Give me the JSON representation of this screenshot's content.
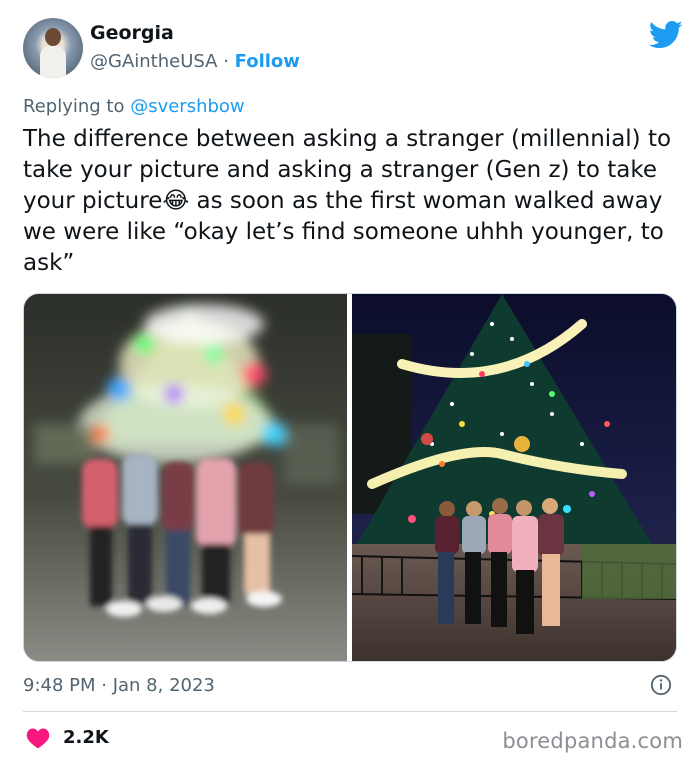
{
  "author": {
    "display_name": "Georgia",
    "handle": "@GAintheUSA",
    "separator": " · ",
    "follow_label": "Follow",
    "avatar_icon": "user-avatar"
  },
  "reply": {
    "prefix": "Replying to ",
    "mention": "@svershbow"
  },
  "tweet": {
    "text_before_emoji": "The difference between asking a stranger (millennial) to take your picture and asking a stranger (Gen z) to take your picture",
    "emoji": "😂",
    "text_after_emoji": " as soon as the first woman walked away we were like “okay let’s find someone uhhh younger, to ask”"
  },
  "media": {
    "left_photo_icon": "blurry-christmas-tree-photo",
    "right_photo_icon": "clear-christmas-tree-photo"
  },
  "meta": {
    "time": "9:48 PM",
    "separator": " · ",
    "date": "Jan 8, 2023",
    "likes": "2.2K"
  },
  "watermark": "boredpanda.com",
  "colors": {
    "accent": "#1d9bf0",
    "like": "#f91880",
    "muted": "#536471"
  }
}
